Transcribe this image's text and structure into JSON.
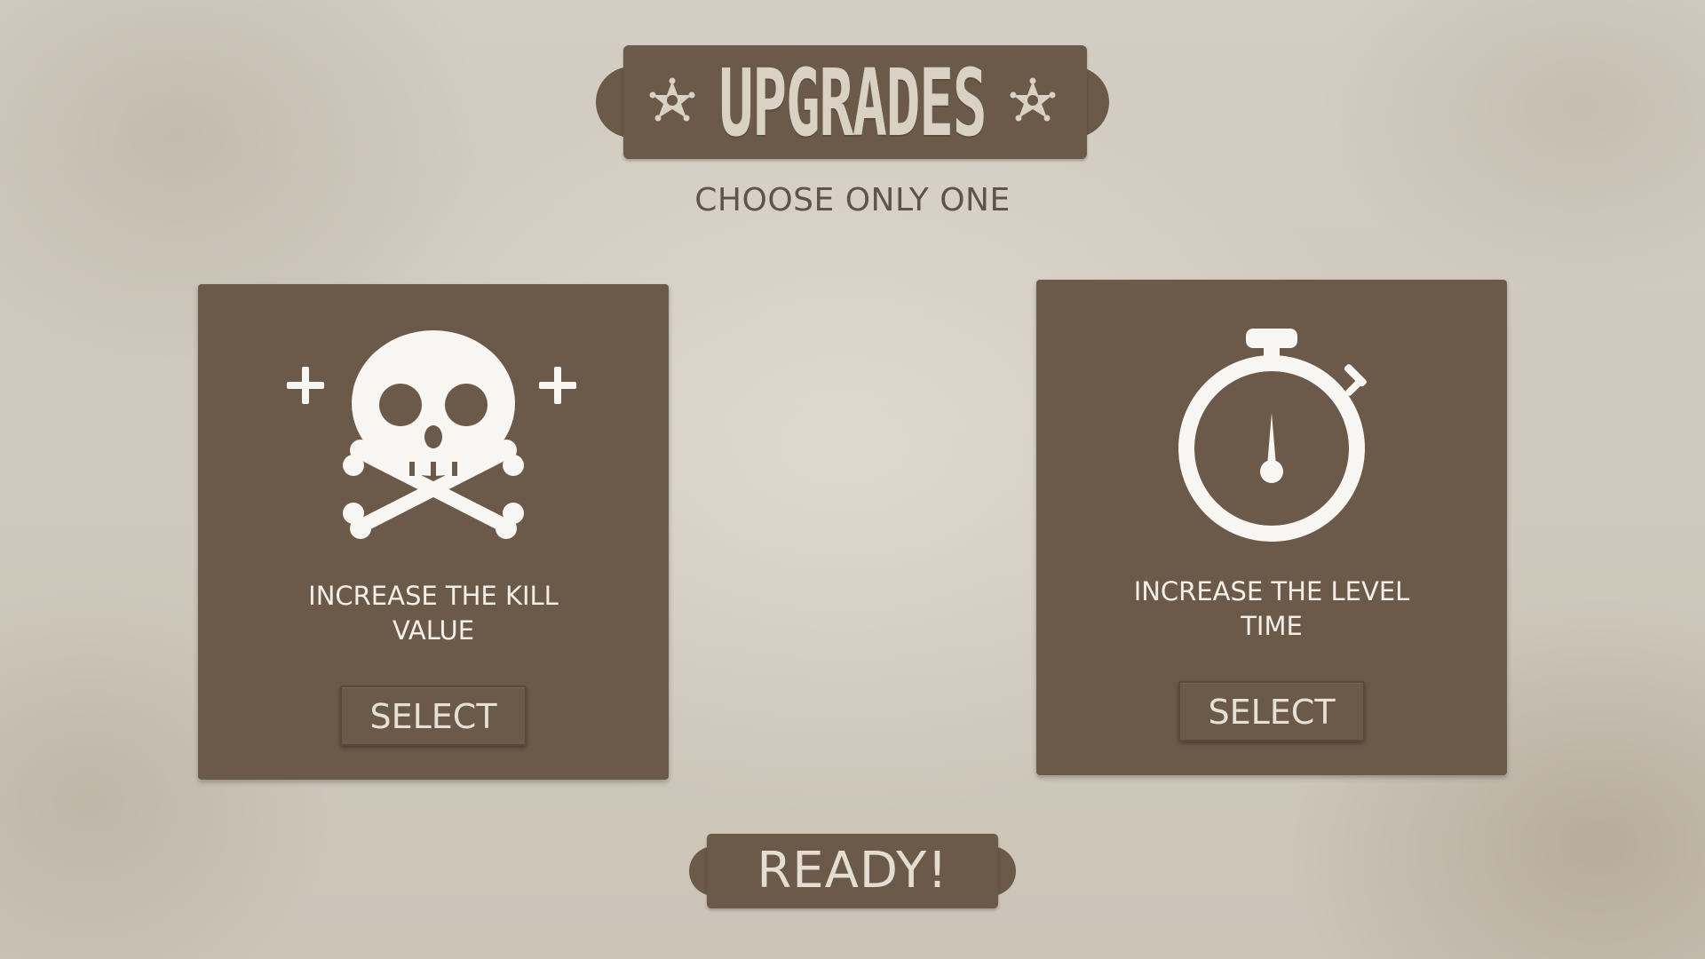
{
  "screen": {
    "title": "UPGRADES",
    "subtitle": "CHOOSE ONLY ONE"
  },
  "upgrades": [
    {
      "icon": "skull-crossbones-plus-icon",
      "label": "INCREASE THE KILL VALUE",
      "button_label": "SELECT"
    },
    {
      "icon": "stopwatch-icon",
      "label": "INCREASE THE LEVEL TIME",
      "button_label": "SELECT"
    }
  ],
  "ready_label": "READY!",
  "colors": {
    "panel": "#6b5a4a",
    "background": "#cfc8bc",
    "title_text": "#d8d1c4",
    "label_text": "#f3efe8",
    "subtitle_text": "#5f534a"
  }
}
